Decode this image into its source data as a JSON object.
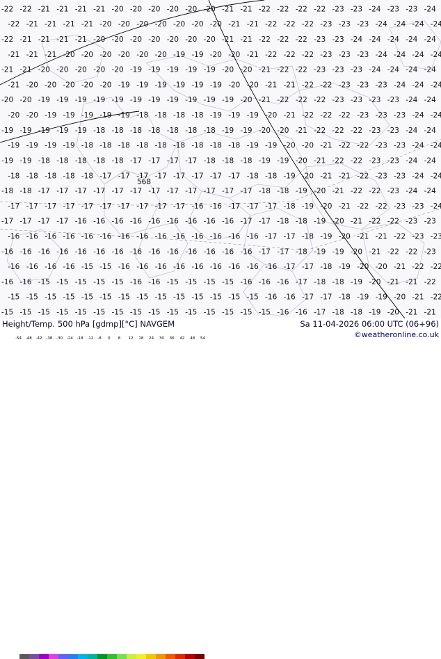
{
  "map": {
    "background": "#f8f8fb",
    "grid_rows": [
      [
        "-22",
        "-22",
        "-21",
        "-21",
        "-21",
        "-21",
        "-20",
        "-20",
        "-20",
        "-20",
        "-20",
        "-20",
        "-21",
        "-21",
        "-22",
        "-22",
        "-22",
        "-22",
        "-23",
        "-23",
        "-24",
        "-23",
        "-23",
        "-24"
      ],
      [
        "-22",
        "-21",
        "-21",
        "-21",
        "-21",
        "-20",
        "-20",
        "-20",
        "-20",
        "-20",
        "-20",
        "-20",
        "-21",
        "-21",
        "-22",
        "-22",
        "-22",
        "-23",
        "-23",
        "-23",
        "-24",
        "-24",
        "-24",
        "-24"
      ],
      [
        "-22",
        "-21",
        "-21",
        "-21",
        "-21",
        "-20",
        "-20",
        "-20",
        "-20",
        "-20",
        "-20",
        "-20",
        "-21",
        "-21",
        "-22",
        "-22",
        "-22",
        "-23",
        "-23",
        "-24",
        "-24",
        "-24",
        "-24",
        "-24"
      ],
      [
        "-21",
        "-21",
        "-21",
        "-20",
        "-20",
        "-20",
        "-20",
        "-20",
        "-20",
        "-19",
        "-19",
        "-20",
        "-20",
        "-21",
        "-22",
        "-22",
        "-22",
        "-23",
        "-23",
        "-23",
        "-24",
        "-24",
        "-24",
        "-24"
      ],
      [
        "-21",
        "-21",
        "-20",
        "-20",
        "-20",
        "-20",
        "-20",
        "-19",
        "-19",
        "-19",
        "-19",
        "-19",
        "-20",
        "-20",
        "-21",
        "-22",
        "-22",
        "-23",
        "-23",
        "-23",
        "-24",
        "-24",
        "-24",
        "-24"
      ],
      [
        "-21",
        "-20",
        "-20",
        "-20",
        "-20",
        "-20",
        "-19",
        "-19",
        "-19",
        "-19",
        "-19",
        "-19",
        "-20",
        "-20",
        "-21",
        "-21",
        "-22",
        "-22",
        "-23",
        "-23",
        "-23",
        "-24",
        "-24",
        "-24"
      ],
      [
        "-20",
        "-20",
        "-19",
        "-19",
        "-19",
        "-19",
        "-19",
        "-19",
        "-19",
        "-19",
        "-19",
        "-19",
        "-19",
        "-20",
        "-21",
        "-22",
        "-22",
        "-22",
        "-23",
        "-23",
        "-23",
        "-23",
        "-24",
        "-24"
      ],
      [
        "-20",
        "-20",
        "-19",
        "-19",
        "-19",
        "-19",
        "-19",
        "-18",
        "-18",
        "-18",
        "-18",
        "-19",
        "-19",
        "-19",
        "-20",
        "-21",
        "-22",
        "-22",
        "-22",
        "-23",
        "-23",
        "-23",
        "-24",
        "-24"
      ],
      [
        "-19",
        "-19",
        "-19",
        "-19",
        "-19",
        "-18",
        "-18",
        "-18",
        "-18",
        "-18",
        "-18",
        "-18",
        "-19",
        "-19",
        "-20",
        "-20",
        "-21",
        "-22",
        "-22",
        "-22",
        "-23",
        "-23",
        "-24",
        "-24"
      ],
      [
        "-19",
        "-19",
        "-19",
        "-19",
        "-18",
        "-18",
        "-18",
        "-18",
        "-18",
        "-18",
        "-18",
        "-18",
        "-18",
        "-19",
        "-19",
        "-20",
        "-20",
        "-21",
        "-22",
        "-22",
        "-23",
        "-23",
        "-24",
        "-24"
      ],
      [
        "-19",
        "-19",
        "-18",
        "-18",
        "-18",
        "-18",
        "-18",
        "-17",
        "-17",
        "-17",
        "-17",
        "-18",
        "-18",
        "-18",
        "-19",
        "-19",
        "-20",
        "-21",
        "-22",
        "-22",
        "-23",
        "-23",
        "-24",
        "-24"
      ],
      [
        "-18",
        "-18",
        "-18",
        "-18",
        "-18",
        "-17",
        "-17",
        "-17",
        "-17",
        "-17",
        "-17",
        "-17",
        "-17",
        "-18",
        "-18",
        "-19",
        "-20",
        "-21",
        "-21",
        "-22",
        "-23",
        "-23",
        "-24",
        "-24"
      ],
      [
        "-18",
        "-18",
        "-17",
        "-17",
        "-17",
        "-17",
        "-17",
        "-17",
        "-17",
        "-17",
        "-17",
        "-17",
        "-17",
        "-17",
        "-18",
        "-18",
        "-19",
        "-20",
        "-21",
        "-22",
        "-22",
        "-23",
        "-24",
        "-24"
      ],
      [
        "-17",
        "-17",
        "-17",
        "-17",
        "-17",
        "-17",
        "-17",
        "-17",
        "-17",
        "-17",
        "-16",
        "-16",
        "-17",
        "-17",
        "-17",
        "-18",
        "-19",
        "-20",
        "-21",
        "-22",
        "-22",
        "-23",
        "-23",
        "-24"
      ],
      [
        "-17",
        "-17",
        "-17",
        "-17",
        "-16",
        "-16",
        "-16",
        "-16",
        "-16",
        "-16",
        "-16",
        "-16",
        "-16",
        "-17",
        "-17",
        "-18",
        "-18",
        "-19",
        "-20",
        "-21",
        "-22",
        "-22",
        "-23",
        "-23"
      ],
      [
        "-16",
        "-16",
        "-16",
        "-16",
        "-16",
        "-16",
        "-16",
        "-16",
        "-16",
        "-16",
        "-16",
        "-16",
        "-16",
        "-16",
        "-17",
        "-17",
        "-18",
        "-19",
        "-20",
        "-21",
        "-21",
        "-22",
        "-23",
        "-23"
      ],
      [
        "-16",
        "-16",
        "-16",
        "-16",
        "-16",
        "-16",
        "-16",
        "-16",
        "-16",
        "-16",
        "-16",
        "-16",
        "-16",
        "-16",
        "-17",
        "-17",
        "-18",
        "-19",
        "-19",
        "-20",
        "-21",
        "-22",
        "-22",
        "-23"
      ],
      [
        "-16",
        "-16",
        "-16",
        "-16",
        "-15",
        "-15",
        "-16",
        "-16",
        "-16",
        "-16",
        "-16",
        "-16",
        "-16",
        "-16",
        "-16",
        "-17",
        "-17",
        "-18",
        "-19",
        "-20",
        "-20",
        "-21",
        "-22",
        "-22"
      ],
      [
        "-16",
        "-16",
        "-15",
        "-15",
        "-15",
        "-15",
        "-15",
        "-16",
        "-16",
        "-15",
        "-15",
        "-15",
        "-15",
        "-16",
        "-16",
        "-16",
        "-17",
        "-18",
        "-18",
        "-19",
        "-20",
        "-21",
        "-21",
        "-22"
      ],
      [
        "-15",
        "-15",
        "-15",
        "-15",
        "-15",
        "-15",
        "-15",
        "-15",
        "-15",
        "-15",
        "-15",
        "-15",
        "-15",
        "-15",
        "-16",
        "-16",
        "-17",
        "-17",
        "-18",
        "-19",
        "-19",
        "-20",
        "-21",
        "-22"
      ],
      [
        "-15",
        "-15",
        "-15",
        "-15",
        "-15",
        "-15",
        "-15",
        "-15",
        "-15",
        "-15",
        "-15",
        "-15",
        "-15",
        "-15",
        "-15",
        "-16",
        "-16",
        "-17",
        "-18",
        "-18",
        "-19",
        "-20",
        "-21",
        "-21"
      ]
    ],
    "geopotential_label": "568",
    "label_color": "#111111",
    "contour_color": "#000000",
    "land_outline_color": "#c0c0d8"
  },
  "footer": {
    "title": "Height/Temp. 500 hPa [gdmp][°C] NAVGEM",
    "datetime": "Sa 11-04-2026 06:00 UTC (06+96)",
    "credit": "©weatheronline.co.uk",
    "colorbar_ticks": [
      "-54",
      "-48",
      "-42",
      "-38",
      "-30",
      "-24",
      "-18",
      "-12",
      "-8",
      "0",
      "8",
      "12",
      "18",
      "24",
      "30",
      "36",
      "42",
      "48",
      "54"
    ],
    "colorbar_colors": [
      "#5a5a5a",
      "#7a4fa0",
      "#a000c8",
      "#e040e0",
      "#6060ff",
      "#2a7ff0",
      "#00b4f0",
      "#00b4a0",
      "#009628",
      "#30c030",
      "#78e050",
      "#c8f03c",
      "#f0f028",
      "#f0c800",
      "#f09600",
      "#f05a00",
      "#e02800",
      "#b40000",
      "#780000"
    ]
  }
}
